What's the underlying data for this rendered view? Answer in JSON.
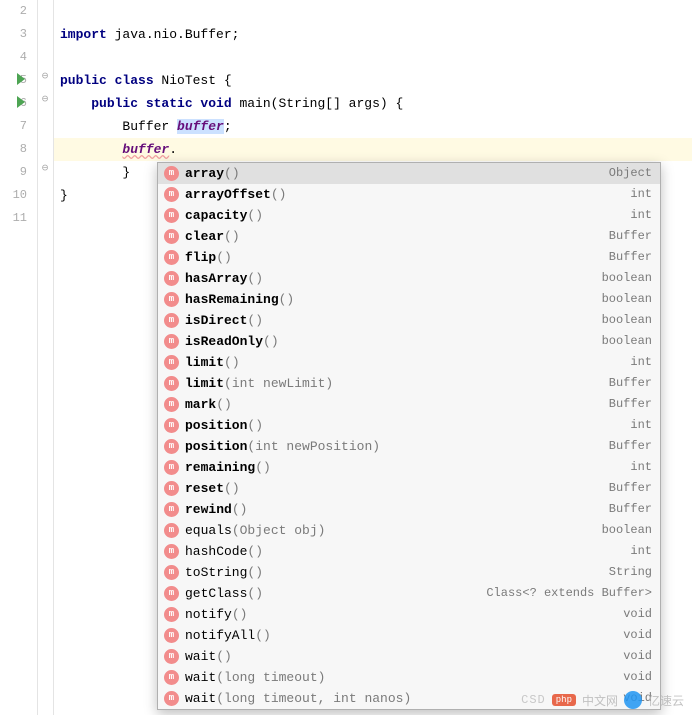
{
  "gutter": {
    "lines": [
      "2",
      "3",
      "4",
      "5",
      "6",
      "7",
      "8",
      "9",
      "10",
      "11"
    ],
    "run_markers": [
      3,
      4
    ]
  },
  "code": {
    "l2": "",
    "l3_kw": "import",
    "l3_rest": " java.nio.Buffer;",
    "l4": "",
    "l5_kw1": "public class",
    "l5_name": " NioTest {",
    "l6_kw": "public static void",
    "l6_name": " main",
    "l6_sig": "(String[] args) {",
    "l7_type": "Buffer ",
    "l7_var": "buffer",
    "l7_semi": ";",
    "l8_var": "buffer",
    "l8_dot": ".",
    "l9": "        }",
    "l10": "}"
  },
  "autocomplete": {
    "items": [
      {
        "icon": "m",
        "name": "array",
        "params": "()",
        "ret": "Object",
        "bold": true,
        "selected": true
      },
      {
        "icon": "m",
        "name": "arrayOffset",
        "params": "()",
        "ret": "int",
        "bold": true
      },
      {
        "icon": "m",
        "name": "capacity",
        "params": "()",
        "ret": "int",
        "bold": true
      },
      {
        "icon": "m",
        "name": "clear",
        "params": "()",
        "ret": "Buffer",
        "bold": true
      },
      {
        "icon": "m",
        "name": "flip",
        "params": "()",
        "ret": "Buffer",
        "bold": true
      },
      {
        "icon": "m",
        "name": "hasArray",
        "params": "()",
        "ret": "boolean",
        "bold": true
      },
      {
        "icon": "m",
        "name": "hasRemaining",
        "params": "()",
        "ret": "boolean",
        "bold": true
      },
      {
        "icon": "m",
        "name": "isDirect",
        "params": "()",
        "ret": "boolean",
        "bold": true
      },
      {
        "icon": "m",
        "name": "isReadOnly",
        "params": "()",
        "ret": "boolean",
        "bold": true
      },
      {
        "icon": "m",
        "name": "limit",
        "params": "()",
        "ret": "int",
        "bold": true
      },
      {
        "icon": "m",
        "name": "limit",
        "params": "(int newLimit)",
        "ret": "Buffer",
        "bold": true
      },
      {
        "icon": "m",
        "name": "mark",
        "params": "()",
        "ret": "Buffer",
        "bold": true
      },
      {
        "icon": "m",
        "name": "position",
        "params": "()",
        "ret": "int",
        "bold": true
      },
      {
        "icon": "m",
        "name": "position",
        "params": "(int newPosition)",
        "ret": "Buffer",
        "bold": true
      },
      {
        "icon": "m",
        "name": "remaining",
        "params": "()",
        "ret": "int",
        "bold": true
      },
      {
        "icon": "m",
        "name": "reset",
        "params": "()",
        "ret": "Buffer",
        "bold": true
      },
      {
        "icon": "m",
        "name": "rewind",
        "params": "()",
        "ret": "Buffer",
        "bold": true
      },
      {
        "icon": "m",
        "name": "equals",
        "params": "(Object obj)",
        "ret": "boolean",
        "bold": false
      },
      {
        "icon": "m",
        "name": "hashCode",
        "params": "()",
        "ret": "int",
        "bold": false
      },
      {
        "icon": "m",
        "name": "toString",
        "params": "()",
        "ret": "String",
        "bold": false
      },
      {
        "icon": "m",
        "name": "getClass",
        "params": "()",
        "ret": "Class<? extends Buffer>",
        "bold": false
      },
      {
        "icon": "m",
        "name": "notify",
        "params": "()",
        "ret": "void",
        "bold": false
      },
      {
        "icon": "m",
        "name": "notifyAll",
        "params": "()",
        "ret": "void",
        "bold": false
      },
      {
        "icon": "m",
        "name": "wait",
        "params": "()",
        "ret": "void",
        "bold": false
      },
      {
        "icon": "m",
        "name": "wait",
        "params": "(long timeout)",
        "ret": "void",
        "bold": false
      },
      {
        "icon": "m",
        "name": "wait",
        "params": "(long timeout, int nanos)",
        "ret": "void",
        "bold": false
      }
    ]
  },
  "watermark": {
    "csd": "CSD",
    "badge": "php",
    "text1": "中文网",
    "text2": "亿速云"
  }
}
